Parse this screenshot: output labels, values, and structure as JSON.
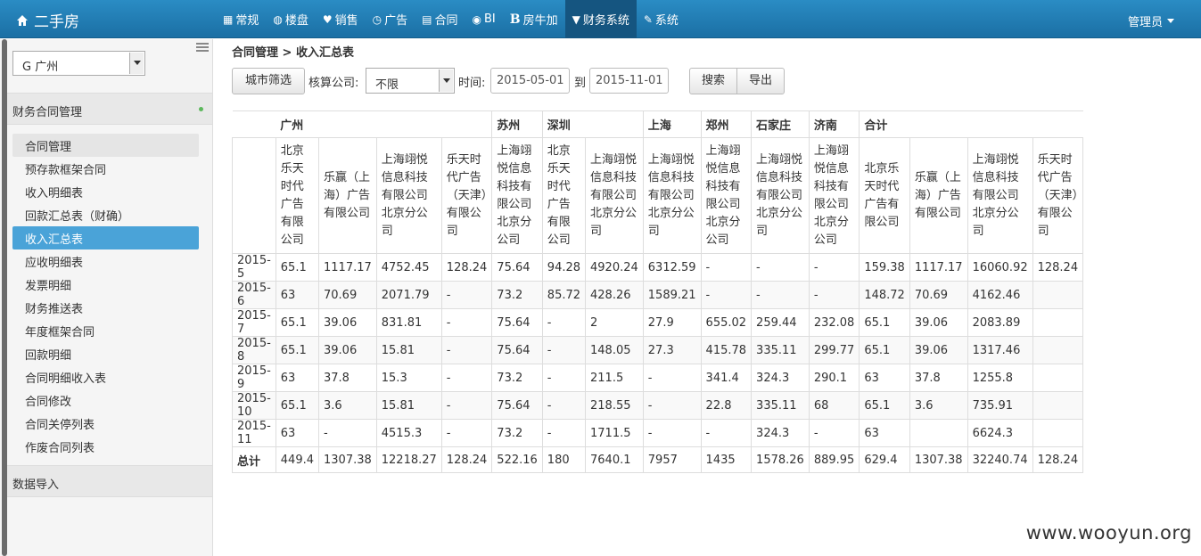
{
  "navbar": {
    "brand": "二手房",
    "items": [
      {
        "icon": "grid-icon",
        "glyph": "▦",
        "label": "常规"
      },
      {
        "icon": "globe-icon",
        "glyph": "◍",
        "label": "楼盘"
      },
      {
        "icon": "heart-icon",
        "glyph": "♥",
        "label": "销售"
      },
      {
        "icon": "clock-icon",
        "glyph": "◷",
        "label": "广告"
      },
      {
        "icon": "file-icon",
        "glyph": "▤",
        "label": "合同"
      },
      {
        "icon": "eye-icon",
        "glyph": "◉",
        "label": "BI"
      },
      {
        "icon": "b-logo-icon",
        "glyph": "B",
        "label": "房牛加"
      },
      {
        "icon": "filter-icon",
        "glyph": "▼",
        "label": "财务系统",
        "active": true
      },
      {
        "icon": "wrench-icon",
        "glyph": "✎",
        "label": "系统"
      }
    ],
    "user": "管理员"
  },
  "sidebar": {
    "city": "G 广州",
    "section_finance": "财务合同管理",
    "menu": [
      "合同管理",
      "预存款框架合同",
      "收入明细表",
      "回款汇总表（财确）",
      "收入汇总表",
      "应收明细表",
      "发票明细",
      "财务推送表",
      "年度框架合同",
      "回款明细",
      "合同明细收入表",
      "合同修改",
      "合同关停列表",
      "作废合同列表"
    ],
    "selected_index": 4,
    "section_import": "数据导入"
  },
  "main": {
    "breadcrumb": "合同管理 > 收入汇总表",
    "city_filter": "城市筛选",
    "company_label": "核算公司:",
    "company_value": "不限",
    "time_label": "时间:",
    "date_from": "2015-05-01",
    "to_label": "到",
    "date_to": "2015-11-01",
    "search": "搜索",
    "export": "导出"
  },
  "table": {
    "cities": [
      {
        "name": "广州",
        "span": 4
      },
      {
        "name": "苏州",
        "span": 1
      },
      {
        "name": "深圳",
        "span": 2
      },
      {
        "name": "上海",
        "span": 1
      },
      {
        "name": "郑州",
        "span": 1
      },
      {
        "name": "石家庄",
        "span": 1
      },
      {
        "name": "济南",
        "span": 1
      },
      {
        "name": "合计",
        "span": 4
      }
    ],
    "companies": [
      "北京乐天时代广告有限公司",
      "乐赢（上海）广告有限公司",
      "上海翊悦信息科技有限公司北京分公司",
      "乐天时代广告（天津）有限公司",
      "上海翊悦信息科技有限公司北京分公司",
      "北京乐天时代广告有限公司",
      "上海翊悦信息科技有限公司北京分公司",
      "上海翊悦信息科技有限公司北京分公司",
      "上海翊悦信息科技有限公司北京分公司",
      "上海翊悦信息科技有限公司北京分公司",
      "上海翊悦信息科技有限公司北京分公司",
      "北京乐天时代广告有限公司",
      "乐赢（上海）广告有限公司",
      "上海翊悦信息科技有限公司北京分公司",
      "乐天时代广告（天津）有限公司"
    ],
    "rows": [
      {
        "period": "2015-5",
        "cells": [
          "65.1",
          "1117.17",
          "4752.45",
          "128.24",
          "75.64",
          "94.28",
          "4920.24",
          "6312.59",
          "-",
          "-",
          "-",
          "159.38",
          "1117.17",
          "16060.92",
          "128.24"
        ]
      },
      {
        "period": "2015-6",
        "cells": [
          "63",
          "70.69",
          "2071.79",
          "-",
          "73.2",
          "85.72",
          "428.26",
          "1589.21",
          "-",
          "-",
          "-",
          "148.72",
          "70.69",
          "4162.46",
          ""
        ]
      },
      {
        "period": "2015-7",
        "cells": [
          "65.1",
          "39.06",
          "831.81",
          "-",
          "75.64",
          "-",
          "2",
          "27.9",
          "655.02",
          "259.44",
          "232.08",
          "65.1",
          "39.06",
          "2083.89",
          ""
        ]
      },
      {
        "period": "2015-8",
        "cells": [
          "65.1",
          "39.06",
          "15.81",
          "-",
          "75.64",
          "-",
          "148.05",
          "27.3",
          "415.78",
          "335.11",
          "299.77",
          "65.1",
          "39.06",
          "1317.46",
          ""
        ]
      },
      {
        "period": "2015-9",
        "cells": [
          "63",
          "37.8",
          "15.3",
          "-",
          "73.2",
          "-",
          "211.5",
          "-",
          "341.4",
          "324.3",
          "290.1",
          "63",
          "37.8",
          "1255.8",
          ""
        ]
      },
      {
        "period": "2015-10",
        "cells": [
          "65.1",
          "3.6",
          "15.81",
          "-",
          "75.64",
          "-",
          "218.55",
          "-",
          "22.8",
          "335.11",
          "68",
          "65.1",
          "3.6",
          "735.91",
          ""
        ]
      },
      {
        "period": "2015-11",
        "cells": [
          "63",
          "-",
          "4515.3",
          "-",
          "73.2",
          "-",
          "1711.5",
          "-",
          "-",
          "324.3",
          "-",
          "63",
          "",
          "6624.3",
          ""
        ]
      }
    ],
    "total": {
      "period": "总计",
      "cells": [
        "449.4",
        "1307.38",
        "12218.27",
        "128.24",
        "522.16",
        "180",
        "7640.1",
        "7957",
        "1435",
        "1578.26",
        "889.95",
        "629.4",
        "1307.38",
        "32240.74",
        "128.24"
      ]
    }
  },
  "watermark": "www.wooyun.org"
}
